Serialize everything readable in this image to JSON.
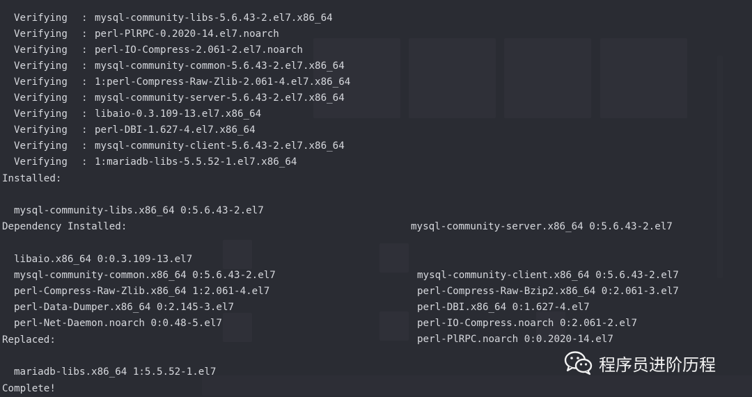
{
  "terminal": {
    "verify_label": "Verifying",
    "verify_lines": [
      "mysql-community-libs-5.6.43-2.el7.x86_64",
      "perl-PlRPC-0.2020-14.el7.noarch",
      "perl-IO-Compress-2.061-2.el7.noarch",
      "mysql-community-common-5.6.43-2.el7.x86_64",
      "1:perl-Compress-Raw-Zlib-2.061-4.el7.x86_64",
      "mysql-community-server-5.6.43-2.el7.x86_64",
      "libaio-0.3.109-13.el7.x86_64",
      "perl-DBI-1.627-4.el7.x86_64",
      "mysql-community-client-5.6.43-2.el7.x86_64",
      "1:mariadb-libs-5.5.52-1.el7.x86_64"
    ],
    "installed_header": "Installed:",
    "installed": [
      [
        "mysql-community-libs.x86_64 0:5.6.43-2.el7",
        "mysql-community-server.x86_64 0:5.6.43-2.el7"
      ]
    ],
    "dependency_header": "Dependency Installed:",
    "dependency": [
      [
        "libaio.x86_64 0:0.3.109-13.el7",
        "mysql-community-client.x86_64 0:5.6.43-2.el7"
      ],
      [
        "mysql-community-common.x86_64 0:5.6.43-2.el7",
        "perl-Compress-Raw-Bzip2.x86_64 0:2.061-3.el7"
      ],
      [
        "perl-Compress-Raw-Zlib.x86_64 1:2.061-4.el7",
        "perl-DBI.x86_64 0:1.627-4.el7"
      ],
      [
        "perl-Data-Dumper.x86_64 0:2.145-3.el7",
        "perl-IO-Compress.noarch 0:2.061-2.el7"
      ],
      [
        "perl-Net-Daemon.noarch 0:0.48-5.el7",
        "perl-PlRPC.noarch 0:0.2020-14.el7"
      ]
    ],
    "replaced_header": "Replaced:",
    "replaced": [
      "mariadb-libs.x86_64 1:5.5.52-1.el7"
    ],
    "complete": "Complete!"
  },
  "watermark": {
    "text": "程序员进阶历程",
    "icon": "wechat-icon"
  },
  "colors": {
    "background": "#2a2c33",
    "text": "#d7d9de",
    "watermark": "#f2f2f2"
  }
}
